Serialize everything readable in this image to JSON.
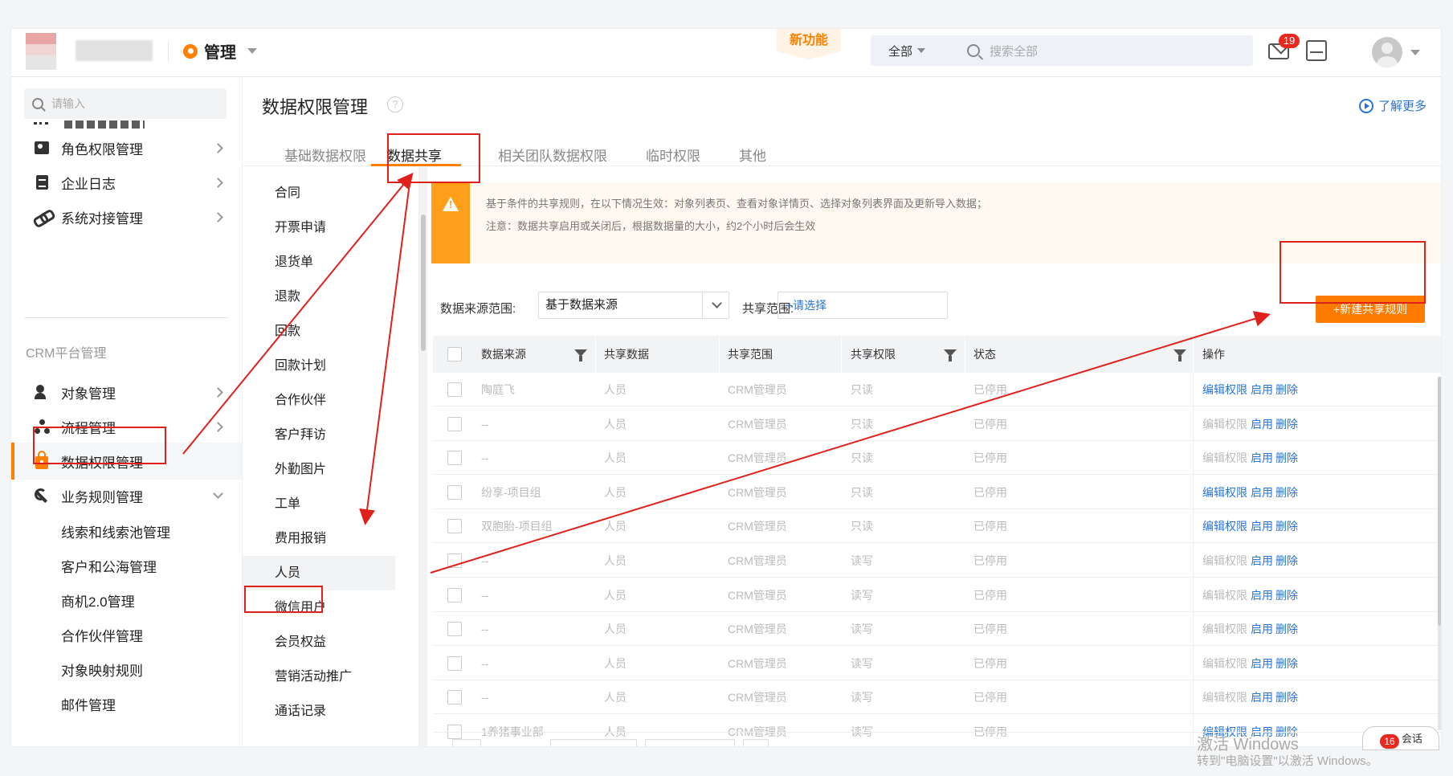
{
  "topbar": {
    "app_label": "管理",
    "new_feature": "新功能",
    "search_scope": "全部",
    "search_placeholder": "搜索全部",
    "mail_badge": "19"
  },
  "sidebar": {
    "search_placeholder": "请输入",
    "items": [
      {
        "label": "角色权限管理",
        "icon": "role-icon"
      },
      {
        "label": "企业日志",
        "icon": "log-icon"
      },
      {
        "label": "系统对接管理",
        "icon": "link-icon"
      }
    ],
    "group_label": "CRM平台管理",
    "crm_items": [
      {
        "label": "对象管理",
        "icon": "object-icon"
      },
      {
        "label": "流程管理",
        "icon": "flow-icon"
      },
      {
        "label": "数据权限管理",
        "icon": "lock-icon"
      },
      {
        "label": "业务规则管理",
        "icon": "wrench-icon"
      }
    ],
    "sub_items": [
      "线索和线索池管理",
      "客户和公海管理",
      "商机2.0管理",
      "合作伙伴管理",
      "对象映射规则",
      "邮件管理"
    ]
  },
  "main": {
    "title": "数据权限管理",
    "help": "?",
    "learn_more": "了解更多",
    "tabs": [
      "基础数据权限",
      "数据共享",
      "相关团队数据权限",
      "临时权限",
      "其他"
    ]
  },
  "objects": [
    "合同",
    "开票申请",
    "退货单",
    "退款",
    "回款",
    "回款计划",
    "合作伙伴",
    "客户拜访",
    "外勤图片",
    "工单",
    "费用报销",
    "人员",
    "微信用户",
    "会员权益",
    "营销活动推广",
    "通话记录"
  ],
  "notice": {
    "line1": "基于条件的共享规则，在以下情况生效：对象列表页、查看对象详情页、选择对象列表界面及更新导入数据；",
    "line2": "注意：数据共享启用或关闭后，根据数据量的大小，约2个小时后会生效"
  },
  "filters": {
    "source_label": "数据来源范围:",
    "source_value": "基于数据来源",
    "scope_label": "共享范围:",
    "scope_placeholder": "+请选择",
    "new_rule": "+新建共享规则"
  },
  "table": {
    "headers": [
      "数据来源",
      "共享数据",
      "共享范围",
      "共享权限",
      "状态",
      "操作"
    ],
    "actions": {
      "edit": "编辑权限",
      "enable": "启用",
      "delete": "删除"
    },
    "rows": [
      {
        "source": "陶庭飞",
        "data": "人员",
        "scope": "CRM管理员",
        "perm": "只读",
        "status": "已停用",
        "edit_active": true
      },
      {
        "source": "--",
        "data": "人员",
        "scope": "CRM管理员",
        "perm": "只读",
        "status": "已停用",
        "edit_active": false
      },
      {
        "source": "--",
        "data": "人员",
        "scope": "CRM管理员",
        "perm": "只读",
        "status": "已停用",
        "edit_active": false
      },
      {
        "source": "纷享-项目组",
        "data": "人员",
        "scope": "CRM管理员",
        "perm": "只读",
        "status": "已停用",
        "edit_active": true
      },
      {
        "source": "双胞胎-项目组",
        "data": "人员",
        "scope": "CRM管理员",
        "perm": "只读",
        "status": "已停用",
        "edit_active": true
      },
      {
        "source": "--",
        "data": "人员",
        "scope": "CRM管理员",
        "perm": "读写",
        "status": "已停用",
        "edit_active": false
      },
      {
        "source": "--",
        "data": "人员",
        "scope": "CRM管理员",
        "perm": "读写",
        "status": "已停用",
        "edit_active": false
      },
      {
        "source": "--",
        "data": "人员",
        "scope": "CRM管理员",
        "perm": "读写",
        "status": "已停用",
        "edit_active": false
      },
      {
        "source": "--",
        "data": "人员",
        "scope": "CRM管理员",
        "perm": "读写",
        "status": "已停用",
        "edit_active": false
      },
      {
        "source": "--",
        "data": "人员",
        "scope": "CRM管理员",
        "perm": "读写",
        "status": "已停用",
        "edit_active": false
      },
      {
        "source": "1养猪事业部",
        "data": "人员",
        "scope": "CRM管理员",
        "perm": "读写",
        "status": "已停用",
        "edit_active": true
      }
    ]
  },
  "windows": {
    "activate_title": "激活 Windows",
    "activate_sub": "转到\"电脑设置\"以激活 Windows。",
    "chat_badge": "16",
    "chat_text": "会话"
  },
  "colors": {
    "accent": "#ff7b00",
    "link": "#2a74d6",
    "annotation": "#e0201b"
  }
}
